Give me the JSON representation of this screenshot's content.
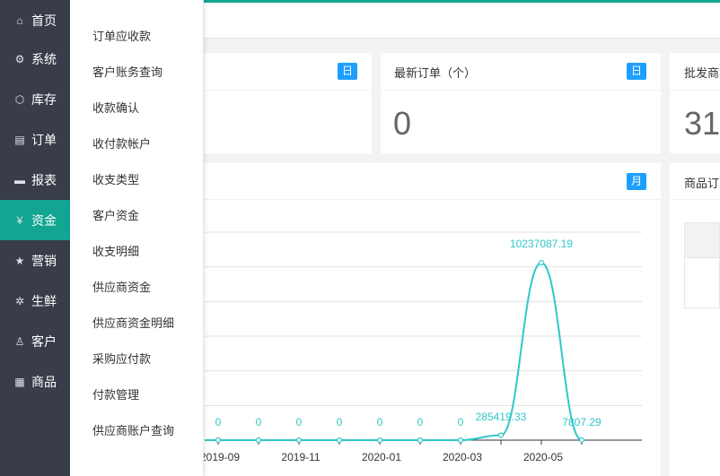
{
  "sidebar": {
    "items": [
      {
        "label": "首页",
        "icon": "home-icon",
        "glyph": "⌂"
      },
      {
        "label": "系统",
        "icon": "gear-icon",
        "glyph": "⚙"
      },
      {
        "label": "库存",
        "icon": "cube-icon",
        "glyph": "⬡"
      },
      {
        "label": "订单",
        "icon": "document-icon",
        "glyph": "▤"
      },
      {
        "label": "报表",
        "icon": "monitor-icon",
        "glyph": "▬"
      },
      {
        "label": "资金",
        "icon": "yen-icon",
        "glyph": "¥"
      },
      {
        "label": "营销",
        "icon": "star-icon",
        "glyph": "★"
      },
      {
        "label": "生鲜",
        "icon": "leaf-icon",
        "glyph": "✲"
      },
      {
        "label": "客户",
        "icon": "user-icon",
        "glyph": "♙"
      },
      {
        "label": "商品",
        "icon": "grid-icon",
        "glyph": "▦"
      }
    ],
    "active_index": 5,
    "accent_color": "#12a591"
  },
  "submenu": {
    "items": [
      "订单应收款",
      "客户账务查询",
      "收款确认",
      "收付款帐户",
      "收支类型",
      "客户资金",
      "收支明细",
      "供应商资金",
      "供应商资金明细",
      "采购应付款",
      "付款管理",
      "供应商账户查询"
    ]
  },
  "cards": {
    "card1": {
      "badge": "日"
    },
    "latest_orders": {
      "title": "最新订单（个）",
      "badge": "日",
      "value": "0"
    },
    "wholesale": {
      "title": "批发商",
      "value": "31"
    },
    "chart_card": {
      "badge": "月"
    },
    "products": {
      "title": "商品订"
    }
  },
  "chart_data": {
    "type": "line",
    "x": [
      "2019-09",
      "2019-10",
      "2019-11",
      "2019-12",
      "2020-01",
      "2020-02",
      "2020-03",
      "2020-04",
      "2020-05",
      "2020-06"
    ],
    "x_tick_labels": [
      "2019-09",
      "2019-11",
      "2020-01",
      "2020-03",
      "2020-05"
    ],
    "series": [
      {
        "values": [
          0,
          0,
          0,
          0,
          0,
          0,
          0,
          285419.33,
          10237087.19,
          7807.29
        ],
        "color": "#2ec7c9"
      }
    ],
    "data_labels": [
      "0",
      "0",
      "0",
      "0",
      "0",
      "0",
      "0",
      "285419.33",
      "10237087.19",
      "7807.29"
    ],
    "preceding_zero_label": "0",
    "grid": true
  }
}
